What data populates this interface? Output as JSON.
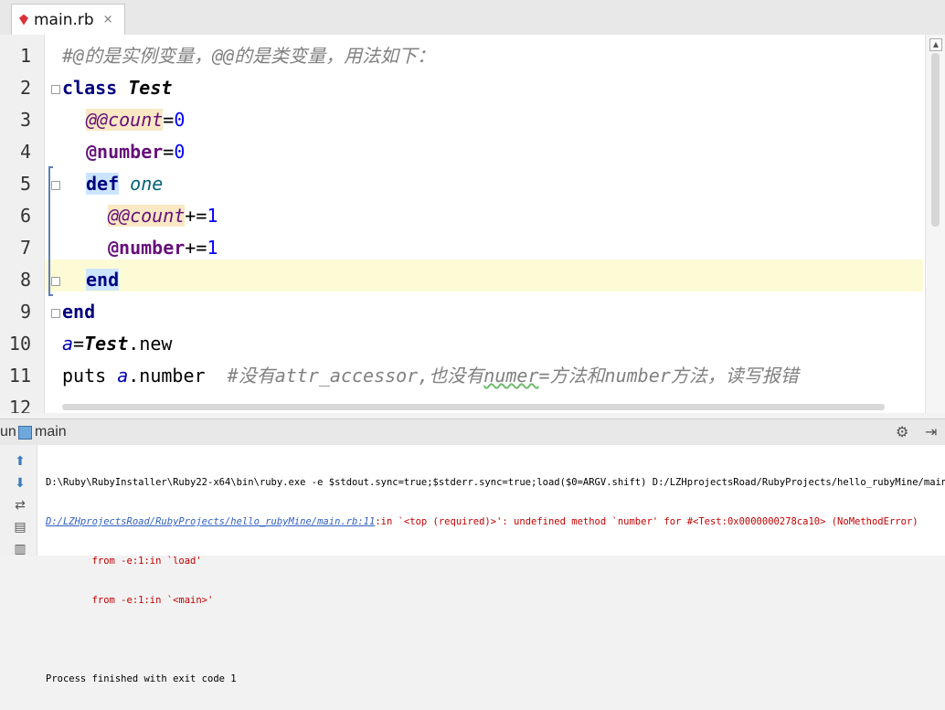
{
  "tab": {
    "filename": "main.rb",
    "close_glyph": "×",
    "icon": "ruby-file-icon"
  },
  "editor": {
    "line_numbers": [
      "1",
      "2",
      "3",
      "4",
      "5",
      "6",
      "7",
      "8",
      "9",
      "10",
      "11",
      "12"
    ],
    "lines": {
      "l1": {
        "comment": "#@的是实例变量，@@的是类变量，用法如下："
      },
      "l2": {
        "kw": "class",
        "name": "Test"
      },
      "l3": {
        "var": "@@count",
        "op": "=",
        "num": "0"
      },
      "l4": {
        "var": "@number",
        "op": "=",
        "num": "0"
      },
      "l5": {
        "kw": "def",
        "name": "one"
      },
      "l6": {
        "var": "@@count",
        "op": "+=",
        "num": "1"
      },
      "l7": {
        "var": "@number",
        "op": "+=",
        "num": "1"
      },
      "l8": {
        "kw": "end"
      },
      "l9": {
        "kw": "end"
      },
      "l10": {
        "lvar": "a",
        "op": "=",
        "cls": "Test",
        "dot": ".",
        "meth": "new"
      },
      "l11": {
        "cmd": "puts ",
        "lvar": "a",
        "rest": ".number",
        "gap": "  ",
        "comment_a": "#没有attr_accessor,也没有",
        "comment_b": "numer",
        "comment_c": "=方法和number方法，读写报错"
      }
    }
  },
  "run_panel": {
    "label": "un",
    "config": "main",
    "icons": [
      "settings-icon",
      "pin-icon"
    ]
  },
  "console": {
    "toolbar": [
      "rerun-up-icon",
      "down-arrow-icon",
      "wrap-icon",
      "print-icon",
      "delete-icon"
    ],
    "cmdline": "D:\\Ruby\\RubyInstaller\\Ruby22-x64\\bin\\ruby.exe -e $stdout.sync=true;$stderr.sync=true;load($0=ARGV.shift) D:/LZHprojectsRoad/RubyProjects/hello_rubyMine/main.rb",
    "error_link": "D:/LZHprojectsRoad/RubyProjects/hello_rubyMine/main.rb:11",
    "error_text": ":in `<top (required)>': undefined method `number' for #<Test:0x0000000278ca10> (NoMethodError)",
    "trace1": "\tfrom -e:1:in `load'",
    "trace2": "\tfrom -e:1:in `<main>'",
    "finished": "Process finished with exit code 1"
  }
}
